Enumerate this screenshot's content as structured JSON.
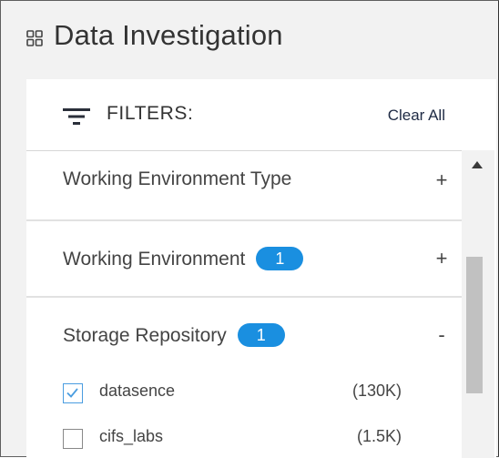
{
  "header": {
    "title": "Data Investigation",
    "icon": "grid-icon"
  },
  "filters": {
    "label": "FILTERS:",
    "icon": "filter-lines-icon",
    "clear_all": "Clear All"
  },
  "sections": [
    {
      "title": "Working Environment Type",
      "badge": null,
      "toggle": "+",
      "expanded": false
    },
    {
      "title": "Working Environment",
      "badge": "1",
      "toggle": "+",
      "expanded": false
    },
    {
      "title": "Storage Repository",
      "badge": "1",
      "toggle": "-",
      "expanded": true,
      "options": [
        {
          "label": "datasence",
          "count": "(130K)",
          "checked": true
        },
        {
          "label": "cifs_labs",
          "count": "(1.5K)",
          "checked": false
        }
      ]
    }
  ],
  "colors": {
    "badge": "#1a8fe0",
    "checkbox_checked": "#4a9de0",
    "header_bg": "#f2f2f2"
  }
}
